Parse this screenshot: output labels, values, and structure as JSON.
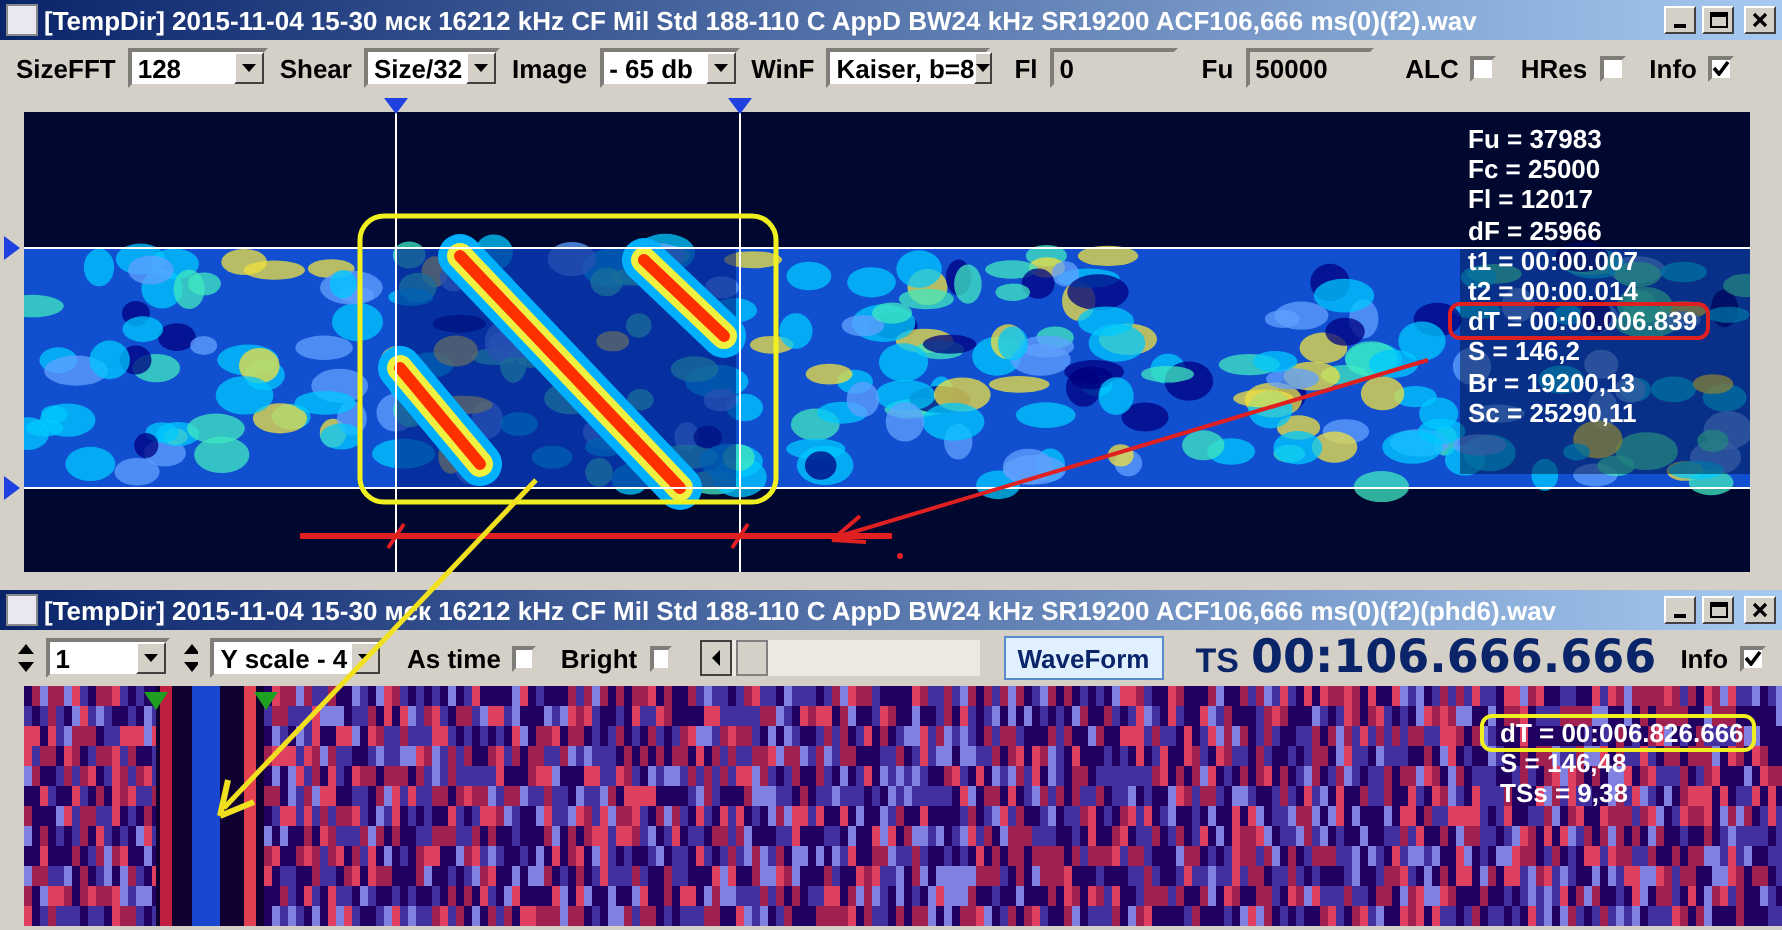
{
  "spectrum_window": {
    "title": "[TempDir] 2015-11-04 15-30 мск 16212 kHz CF Mil Std 188-110 C AppD BW24 kHz SR19200 ACF106,666 ms(0)(f2).wav",
    "toolbar": [
      {
        "kind": "dropdown",
        "label": "SizeFFT",
        "value": "128"
      },
      {
        "kind": "dropdown",
        "label": "Shear",
        "value": "Size/32"
      },
      {
        "kind": "dropdown",
        "label": "Image",
        "value": "- 65 db"
      },
      {
        "kind": "dropdown",
        "label": "WinF",
        "value": "Kaiser, b=8"
      },
      {
        "kind": "field",
        "label": "Fl",
        "value": "0"
      },
      {
        "kind": "field",
        "label": "Fu",
        "value": "50000"
      },
      {
        "kind": "checkbox",
        "label": "ALC",
        "checked": false
      },
      {
        "kind": "checkbox",
        "label": "HRes",
        "checked": false
      },
      {
        "kind": "checkbox",
        "label": "Info",
        "checked": true
      }
    ],
    "readout": [
      {
        "text": "Fu = 37983",
        "circled": false
      },
      {
        "text": "Fc = 25000",
        "circled": false
      },
      {
        "text": "Fl = 12017",
        "circled": false
      },
      {
        "text": "dF = 25966",
        "circled": false
      },
      {
        "text": "t1 = 00:00.007",
        "circled": false
      },
      {
        "text": "t2 = 00:00.014",
        "circled": false
      },
      {
        "text": "dT = 00:00.006.839",
        "circled": true
      },
      {
        "text": "S = 146,2",
        "circled": false
      },
      {
        "text": "Br = 19200,13",
        "circled": false
      },
      {
        "text": "Sc = 25290,11",
        "circled": false
      }
    ]
  },
  "phase_window": {
    "title": "[TempDir] 2015-11-04 15-30 мск 16212 kHz CF Mil Std 188-110 C AppD BW24 kHz SR19200 ACF106,666 ms(0)(f2)(phd6).wav",
    "toolbar": [
      {
        "kind": "spinner",
        "value": "1"
      },
      {
        "kind": "dropdown",
        "value": "Y scale - 4"
      },
      {
        "kind": "checkbox",
        "label": "As time",
        "checked": false
      },
      {
        "kind": "checkbox",
        "label": "Bright",
        "checked": false
      },
      {
        "kind": "scrollbar"
      },
      {
        "kind": "button",
        "label": "WaveForm"
      },
      {
        "kind": "readout",
        "label": "TS",
        "value": "00:106.666.666"
      },
      {
        "kind": "checkbox",
        "label": "Info",
        "checked": true
      }
    ],
    "readout": [
      {
        "text": "dT = 00:006.826.666",
        "circled": true
      },
      {
        "text": "S = 146,48",
        "circled": false
      },
      {
        "text": "TSs = 9,38",
        "circled": false
      }
    ]
  }
}
